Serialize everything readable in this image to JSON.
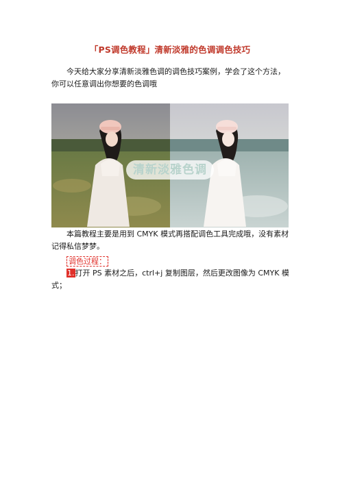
{
  "doc": {
    "title": "「PS调色教程」清新淡雅的色调调色技巧",
    "intro": "今天给大家分享清新淡雅色调的调色技巧案例，学会了这个方法，你可以任意调出你想要的色调哦",
    "image_overlay_text": "清新淡雅色调",
    "para2": "本篇教程主要是用到 CMYK 模式再搭配调色工具完成哦，没有素材记得私信梦梦。",
    "process_label": "调色过程：",
    "step1_number": "1.",
    "step1_text": "打开 PS 素材之后，ctrl+j 复制图层，然后更改图像为 CMYK 模式；"
  },
  "colors": {
    "title": "#c0392b",
    "accent_red": "#e0302a",
    "overlay_text": "#b8d3cc"
  }
}
